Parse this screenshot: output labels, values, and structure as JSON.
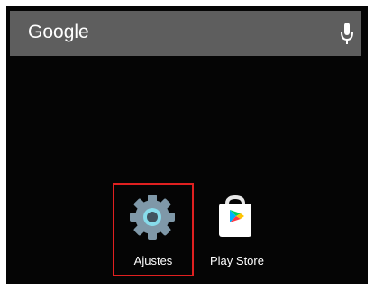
{
  "search_widget": {
    "label": "Google",
    "mic_icon": "microphone-icon"
  },
  "apps": [
    {
      "label": "Ajustes",
      "icon": "settings-gear-icon",
      "highlighted": true
    },
    {
      "label": "Play Store",
      "icon": "play-store-icon",
      "highlighted": false
    }
  ],
  "colors": {
    "screen_background": "#050505",
    "search_bar": "#5e5e5e",
    "highlight_border": "#e02020",
    "gear_body": "#7f98a8",
    "gear_ring": "#87dceb"
  }
}
